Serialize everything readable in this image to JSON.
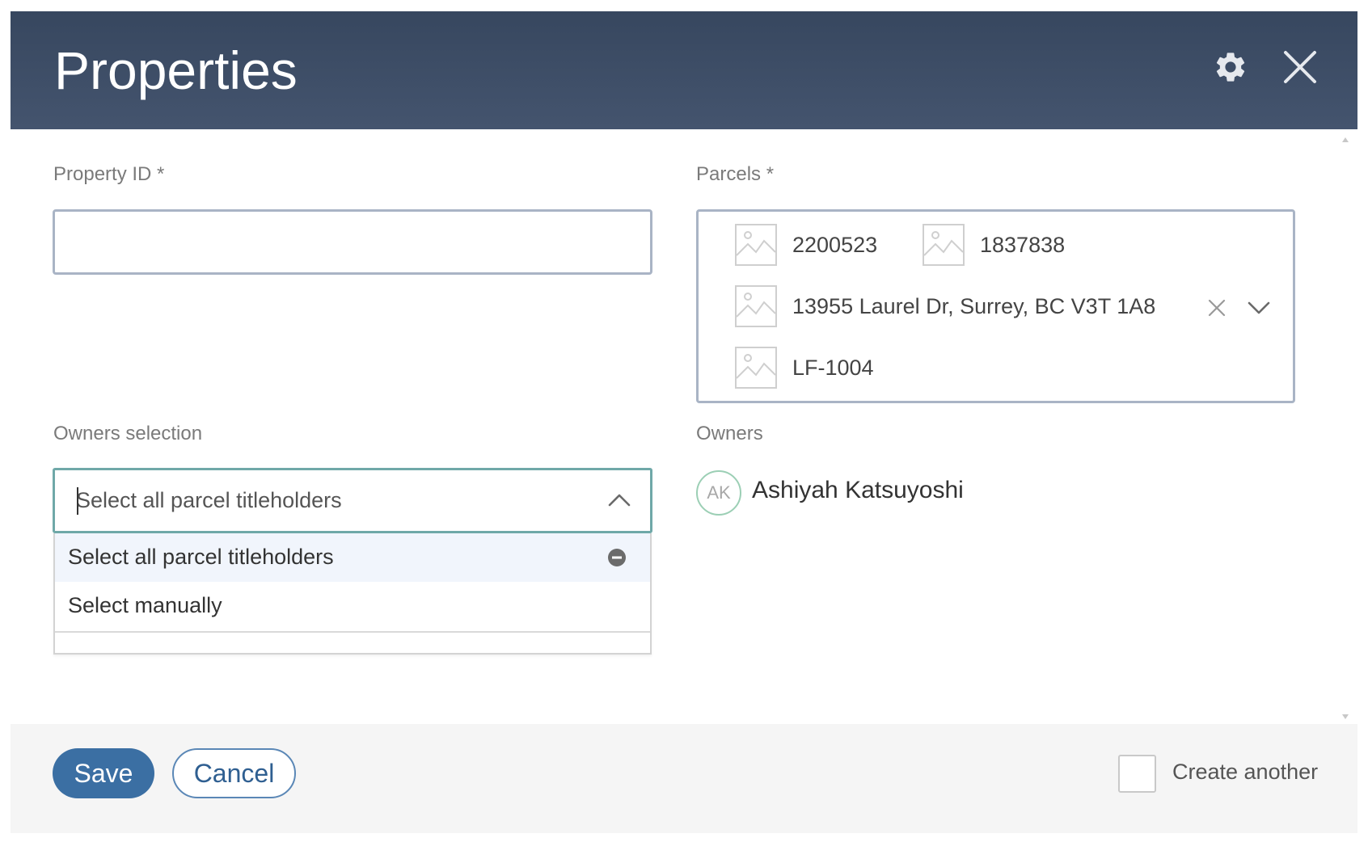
{
  "dialog": {
    "title": "Properties",
    "header_icons": [
      "gear-icon",
      "close-icon"
    ]
  },
  "property_id": {
    "label": "Property ID *",
    "value": "",
    "placeholder": ""
  },
  "parcels": {
    "label": "Parcels *",
    "chips": [
      {
        "label": "2200523",
        "icon": "image-placeholder-icon"
      },
      {
        "label": "1837838",
        "icon": "image-placeholder-icon"
      },
      {
        "label": "13955 Laurel Dr, Surrey, BC V3T 1A8",
        "icon": "image-placeholder-icon"
      },
      {
        "label": "LF-1004",
        "icon": "image-placeholder-icon"
      }
    ],
    "controls": [
      "clear-icon",
      "chevron-down-icon"
    ]
  },
  "owners_selection": {
    "label": "Owners selection",
    "value": "Select all parcel titleholders",
    "expanded": true,
    "options": [
      {
        "label": "Select all parcel titleholders",
        "selected": true
      },
      {
        "label": "Select manually",
        "selected": false
      }
    ]
  },
  "owners": {
    "label": "Owners",
    "list": [
      {
        "initials": "AK",
        "name": "Ashiyah Katsuyoshi"
      }
    ]
  },
  "footer": {
    "save_label": "Save",
    "cancel_label": "Cancel",
    "create_another_label": "Create another",
    "create_another_checked": false
  },
  "colors": {
    "header_bg": "#3d4d66",
    "primary": "#3b6fa3",
    "focus_border": "#6fa8a8",
    "avatar_border": "#9ccfb5",
    "footer_bg": "#f5f5f5"
  }
}
